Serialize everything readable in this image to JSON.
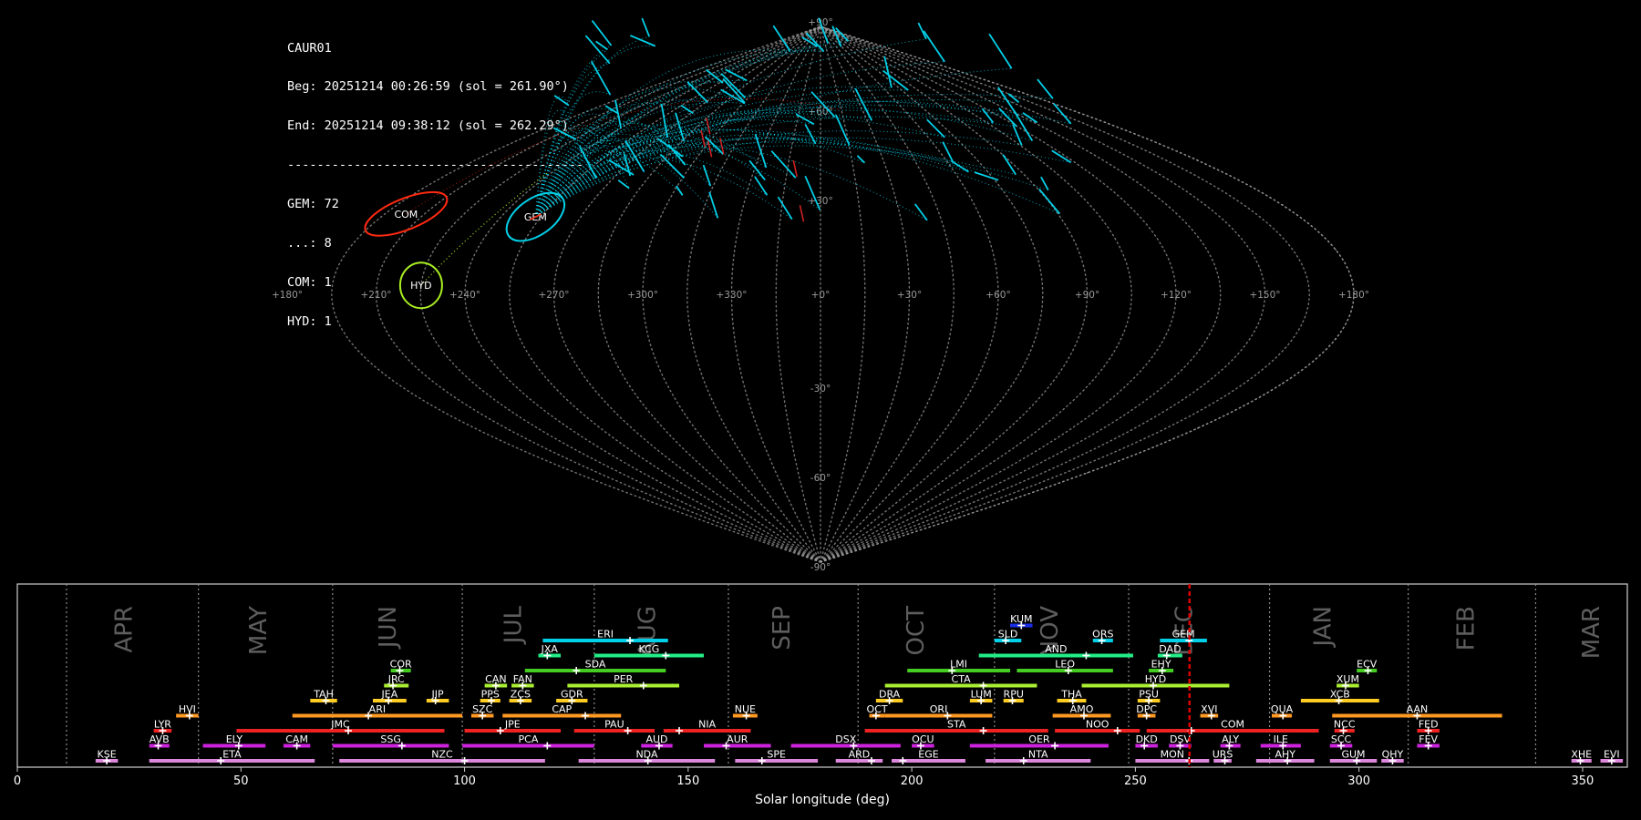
{
  "info": {
    "lines": [
      "CAUR01",
      "Beg: 20251214 00:26:59 (sol = 261.90°)",
      "End: 20251214 09:38:12 (sol = 262.29°)",
      "----------------------------------------",
      "GEM: 72",
      "...: 8",
      "COM: 1",
      "HYD: 1"
    ]
  },
  "colors": {
    "background": "#000000",
    "grid": "#9a9a9a",
    "GEM": "#00d0e8",
    "COM": "#ff2a10",
    "HYD": "#aaee22",
    "sporadic": "#cc2222",
    "current_sol": "#dd0000"
  },
  "chart_data": [
    {
      "type": "scatter",
      "projection": "sinusoidal sky map",
      "lon_ticks": [
        "+180°",
        "+150°",
        "+120°",
        "+90°",
        "+60°",
        "+30°",
        "+0°",
        "+330°",
        "+300°",
        "+270°",
        "+240°",
        "+210°",
        "+180°"
      ],
      "lat_ticks": [
        "+90°",
        "+60°",
        "+30°",
        "-30°",
        "-60°",
        "-90°"
      ],
      "radiants": [
        {
          "label": "COM",
          "lon": 157,
          "lat": 27,
          "color": "#ff2a10"
        },
        {
          "label": "GEM",
          "lon": 107,
          "lat": 26,
          "color": "#00d0e8"
        },
        {
          "label": "HYD",
          "lon": 135,
          "lat": 3,
          "color": "#aaee22"
        }
      ],
      "grid": true
    },
    {
      "type": "gantt",
      "xlabel": "Solar longitude (deg)",
      "xlim": [
        0,
        360
      ],
      "xticks": [
        0,
        50,
        100,
        150,
        200,
        250,
        300,
        350
      ],
      "current_sol": 262.1,
      "months": [
        {
          "name": "APR",
          "start": 11,
          "label": 24
        },
        {
          "name": "MAY",
          "start": 40.5,
          "label": 54
        },
        {
          "name": "JUN",
          "start": 70.5,
          "label": 83
        },
        {
          "name": "JUL",
          "start": 99.5,
          "label": 111
        },
        {
          "name": "AUG",
          "start": 129,
          "label": 141
        },
        {
          "name": "SEP",
          "start": 159,
          "label": 171
        },
        {
          "name": "OCT",
          "start": 188,
          "label": 201
        },
        {
          "name": "NOV",
          "start": 218.5,
          "label": 231
        },
        {
          "name": "DEC",
          "start": 248.5,
          "label": 261
        },
        {
          "name": "JAN",
          "start": 280,
          "label": 292
        },
        {
          "name": "FEB",
          "start": 311,
          "label": 324
        },
        {
          "name": "MAR",
          "start": 339.5,
          "label": 352
        }
      ],
      "showers": [
        {
          "code": "KUM",
          "start": 222,
          "end": 227,
          "peak": 224.5,
          "row": 10,
          "color": "#1a2ee8"
        },
        {
          "code": "ERI",
          "start": 117.5,
          "end": 145.5,
          "peak": 137,
          "row": 9,
          "color": "#00d0e8"
        },
        {
          "code": "SLD",
          "start": 218.5,
          "end": 224.5,
          "peak": 221,
          "row": 9,
          "color": "#00d0e8"
        },
        {
          "code": "ORS",
          "start": 240.5,
          "end": 245,
          "peak": 242.5,
          "row": 9,
          "color": "#00d0e8"
        },
        {
          "code": "GEM",
          "start": 255.5,
          "end": 266,
          "peak": 262,
          "row": 9,
          "color": "#00d0e8"
        },
        {
          "code": "JXA",
          "start": 116.5,
          "end": 121.5,
          "peak": 118.5,
          "row": 8,
          "color": "#22ee88"
        },
        {
          "code": "KCG",
          "start": 129,
          "end": 153.5,
          "peak": 145,
          "row": 8,
          "color": "#22ee88"
        },
        {
          "code": "AND",
          "start": 215,
          "end": 249.5,
          "peak": 239,
          "row": 8,
          "color": "#22ee88"
        },
        {
          "code": "DAD",
          "start": 255,
          "end": 260.5,
          "peak": 257,
          "row": 8,
          "color": "#22ee88"
        },
        {
          "code": "COR",
          "start": 83.5,
          "end": 88,
          "peak": 85.5,
          "row": 7,
          "color": "#44cc22"
        },
        {
          "code": "SDA",
          "start": 113.5,
          "end": 145,
          "peak": 125,
          "row": 7,
          "color": "#44cc22"
        },
        {
          "code": "LMI",
          "start": 199,
          "end": 222,
          "peak": 209,
          "row": 7,
          "color": "#44cc22"
        },
        {
          "code": "LEO",
          "start": 223.5,
          "end": 245,
          "peak": 235,
          "row": 7,
          "color": "#44cc22"
        },
        {
          "code": "EHY",
          "start": 253,
          "end": 258.5,
          "peak": 256,
          "row": 7,
          "color": "#44cc22"
        },
        {
          "code": "ECV",
          "start": 299.5,
          "end": 304,
          "peak": 302,
          "row": 7,
          "color": "#44cc22"
        },
        {
          "code": "JRC",
          "start": 82,
          "end": 87.5,
          "peak": 84,
          "row": 6,
          "color": "#aaee33"
        },
        {
          "code": "CAN",
          "start": 104.5,
          "end": 109.5,
          "peak": 107,
          "row": 6,
          "color": "#aaee33"
        },
        {
          "code": "FAN",
          "start": 110.5,
          "end": 115.5,
          "peak": 113,
          "row": 6,
          "color": "#aaee33"
        },
        {
          "code": "PER",
          "start": 123,
          "end": 148,
          "peak": 140,
          "row": 6,
          "color": "#aaee33"
        },
        {
          "code": "CTA",
          "start": 194,
          "end": 228,
          "peak": 216,
          "row": 6,
          "color": "#aaee33"
        },
        {
          "code": "HYD",
          "start": 238,
          "end": 271,
          "peak": 254,
          "row": 6,
          "color": "#aaee33"
        },
        {
          "code": "XUM",
          "start": 295,
          "end": 300,
          "peak": 297,
          "row": 6,
          "color": "#aaee33"
        },
        {
          "code": "TAH",
          "start": 65.5,
          "end": 71.5,
          "peak": 69,
          "row": 5,
          "color": "#ffcc22"
        },
        {
          "code": "JEA",
          "start": 79.5,
          "end": 87,
          "peak": 83,
          "row": 5,
          "color": "#ffcc22"
        },
        {
          "code": "JIP",
          "start": 91.5,
          "end": 96.5,
          "peak": 93.5,
          "row": 5,
          "color": "#ffcc22"
        },
        {
          "code": "PPS",
          "start": 103.5,
          "end": 108,
          "peak": 106,
          "row": 5,
          "color": "#ffcc22"
        },
        {
          "code": "ZCS",
          "start": 110,
          "end": 115,
          "peak": 112.5,
          "row": 5,
          "color": "#ffcc22"
        },
        {
          "code": "GDR",
          "start": 120.5,
          "end": 127.5,
          "peak": 124,
          "row": 5,
          "color": "#ffcc22"
        },
        {
          "code": "DRA",
          "start": 192,
          "end": 198,
          "peak": 195,
          "row": 5,
          "color": "#ffcc22"
        },
        {
          "code": "LUM",
          "start": 213,
          "end": 218,
          "peak": 215.5,
          "row": 5,
          "color": "#ffcc22"
        },
        {
          "code": "RPU",
          "start": 220.5,
          "end": 225,
          "peak": 222.5,
          "row": 5,
          "color": "#ffcc22"
        },
        {
          "code": "THA",
          "start": 232.5,
          "end": 239,
          "peak": 236,
          "row": 5,
          "color": "#ffcc22"
        },
        {
          "code": "PSU",
          "start": 250.5,
          "end": 255.5,
          "peak": 253,
          "row": 5,
          "color": "#ffcc22"
        },
        {
          "code": "XCB",
          "start": 287,
          "end": 304.5,
          "peak": 295.5,
          "row": 5,
          "color": "#ffcc22"
        },
        {
          "code": "HVI",
          "start": 35.5,
          "end": 40.5,
          "peak": 38.5,
          "row": 4,
          "color": "#ff9922"
        },
        {
          "code": "ARI",
          "start": 61.5,
          "end": 99.5,
          "peak": 78.5,
          "row": 4,
          "color": "#ff9922"
        },
        {
          "code": "SZC",
          "start": 101.5,
          "end": 106.5,
          "peak": 104,
          "row": 4,
          "color": "#ff9922"
        },
        {
          "code": "CAP",
          "start": 108.5,
          "end": 135,
          "peak": 127,
          "row": 4,
          "color": "#ff9922"
        },
        {
          "code": "NUE",
          "start": 160,
          "end": 165.5,
          "peak": 163,
          "row": 4,
          "color": "#ff9922"
        },
        {
          "code": "OCT",
          "start": 190.5,
          "end": 194,
          "peak": 192,
          "row": 4,
          "color": "#ff9922"
        },
        {
          "code": "ORI",
          "start": 194,
          "end": 218,
          "peak": 208,
          "row": 4,
          "color": "#ff9922"
        },
        {
          "code": "AMO",
          "start": 231.5,
          "end": 244.5,
          "peak": 238.5,
          "row": 4,
          "color": "#ff9922"
        },
        {
          "code": "DPC",
          "start": 250.5,
          "end": 254.5,
          "peak": 252.5,
          "row": 4,
          "color": "#ff9922"
        },
        {
          "code": "XVI",
          "start": 264.5,
          "end": 268.5,
          "peak": 267,
          "row": 4,
          "color": "#ff9922"
        },
        {
          "code": "QUA",
          "start": 280.5,
          "end": 285,
          "peak": 283,
          "row": 4,
          "color": "#ff9922"
        },
        {
          "code": "AAN",
          "start": 294,
          "end": 332,
          "peak": 313,
          "row": 4,
          "color": "#ff9922"
        },
        {
          "code": "LYR",
          "start": 30.5,
          "end": 34.5,
          "peak": 32.5,
          "row": 3,
          "color": "#ee2222"
        },
        {
          "code": "JMC",
          "start": 49,
          "end": 95.5,
          "peak": 74,
          "row": 3,
          "color": "#ee2222"
        },
        {
          "code": "JPE",
          "start": 100,
          "end": 121.5,
          "peak": 108,
          "row": 3,
          "color": "#ee2222"
        },
        {
          "code": "PAU",
          "start": 124.5,
          "end": 142.5,
          "peak": 136.5,
          "row": 3,
          "color": "#ee2222"
        },
        {
          "code": "NIA",
          "start": 144.5,
          "end": 164,
          "peak": 148,
          "row": 3,
          "color": "#ee2222"
        },
        {
          "code": "STA",
          "start": 189.5,
          "end": 230.5,
          "peak": 216,
          "row": 3,
          "color": "#ee2222"
        },
        {
          "code": "NOO",
          "start": 232,
          "end": 251,
          "peak": 246,
          "row": 3,
          "color": "#ee2222"
        },
        {
          "code": "COM",
          "start": 252.5,
          "end": 291,
          "peak": 262.5,
          "row": 3,
          "color": "#ee2222"
        },
        {
          "code": "NCC",
          "start": 294.5,
          "end": 299,
          "peak": 296.5,
          "row": 3,
          "color": "#ee2222"
        },
        {
          "code": "FED",
          "start": 313,
          "end": 318,
          "peak": 315.5,
          "row": 3,
          "color": "#ee2222"
        },
        {
          "code": "AVB",
          "start": 29.5,
          "end": 34,
          "peak": 31.5,
          "row": 2,
          "color": "#cc22dd"
        },
        {
          "code": "ELY",
          "start": 41.5,
          "end": 55.5,
          "peak": 49.5,
          "row": 2,
          "color": "#cc22dd"
        },
        {
          "code": "CAM",
          "start": 59.5,
          "end": 65.5,
          "peak": 62.5,
          "row": 2,
          "color": "#cc22dd"
        },
        {
          "code": "SSG",
          "start": 70.5,
          "end": 96.5,
          "peak": 86,
          "row": 2,
          "color": "#cc22dd"
        },
        {
          "code": "PCA",
          "start": 99.5,
          "end": 129,
          "peak": 118.5,
          "row": 2,
          "color": "#cc22dd"
        },
        {
          "code": "AUD",
          "start": 139.5,
          "end": 146.5,
          "peak": 143.5,
          "row": 2,
          "color": "#cc22dd"
        },
        {
          "code": "AUR",
          "start": 153.5,
          "end": 168.5,
          "peak": 158.5,
          "row": 2,
          "color": "#cc22dd"
        },
        {
          "code": "DSX",
          "start": 173,
          "end": 197.5,
          "peak": 187,
          "row": 2,
          "color": "#cc22dd"
        },
        {
          "code": "OCU",
          "start": 200,
          "end": 205,
          "peak": 202,
          "row": 2,
          "color": "#cc22dd"
        },
        {
          "code": "OER",
          "start": 213,
          "end": 244,
          "peak": 232,
          "row": 2,
          "color": "#cc22dd"
        },
        {
          "code": "DKD",
          "start": 250,
          "end": 255,
          "peak": 252,
          "row": 2,
          "color": "#cc22dd"
        },
        {
          "code": "DSV",
          "start": 257.5,
          "end": 262.5,
          "peak": 260,
          "row": 2,
          "color": "#cc22dd"
        },
        {
          "code": "ALY",
          "start": 269,
          "end": 273.5,
          "peak": 271,
          "row": 2,
          "color": "#cc22dd"
        },
        {
          "code": "ILE",
          "start": 278,
          "end": 287,
          "peak": 283,
          "row": 2,
          "color": "#cc22dd"
        },
        {
          "code": "SCC",
          "start": 293.5,
          "end": 298.5,
          "peak": 296,
          "row": 2,
          "color": "#cc22dd"
        },
        {
          "code": "FEV",
          "start": 313,
          "end": 318,
          "peak": 315.5,
          "row": 2,
          "color": "#cc22dd"
        },
        {
          "code": "KSE",
          "start": 17.5,
          "end": 22.5,
          "peak": 20,
          "row": 1,
          "color": "#dd88dd"
        },
        {
          "code": "ETA",
          "start": 29.5,
          "end": 66.5,
          "peak": 45.5,
          "row": 1,
          "color": "#dd88dd"
        },
        {
          "code": "NZC",
          "start": 72,
          "end": 118,
          "peak": 100,
          "row": 1,
          "color": "#dd88dd"
        },
        {
          "code": "NDA",
          "start": 125.5,
          "end": 156,
          "peak": 141,
          "row": 1,
          "color": "#dd88dd"
        },
        {
          "code": "SPE",
          "start": 160.5,
          "end": 179,
          "peak": 166.5,
          "row": 1,
          "color": "#dd88dd"
        },
        {
          "code": "ARD",
          "start": 183,
          "end": 193.5,
          "peak": 191,
          "row": 1,
          "color": "#dd88dd"
        },
        {
          "code": "EGE",
          "start": 195.5,
          "end": 212,
          "peak": 198,
          "row": 1,
          "color": "#dd88dd"
        },
        {
          "code": "NTA",
          "start": 216.5,
          "end": 240,
          "peak": 225,
          "row": 1,
          "color": "#dd88dd"
        },
        {
          "code": "MON",
          "start": 250,
          "end": 266.5,
          "peak": 262,
          "row": 1,
          "color": "#dd88dd"
        },
        {
          "code": "URS",
          "start": 267.5,
          "end": 271.5,
          "peak": 270,
          "row": 1,
          "color": "#dd88dd"
        },
        {
          "code": "AHY",
          "start": 277,
          "end": 290,
          "peak": 284,
          "row": 1,
          "color": "#dd88dd"
        },
        {
          "code": "GUM",
          "start": 293.5,
          "end": 304,
          "peak": 299.5,
          "row": 1,
          "color": "#dd88dd"
        },
        {
          "code": "QHY",
          "start": 305,
          "end": 310,
          "peak": 307.5,
          "row": 1,
          "color": "#dd88dd"
        },
        {
          "code": "XHE",
          "start": 347.5,
          "end": 352,
          "peak": 349.5,
          "row": 1,
          "color": "#dd88dd"
        },
        {
          "code": "EVI",
          "start": 354,
          "end": 359,
          "peak": 356.5,
          "row": 1,
          "color": "#dd88dd"
        }
      ]
    }
  ]
}
